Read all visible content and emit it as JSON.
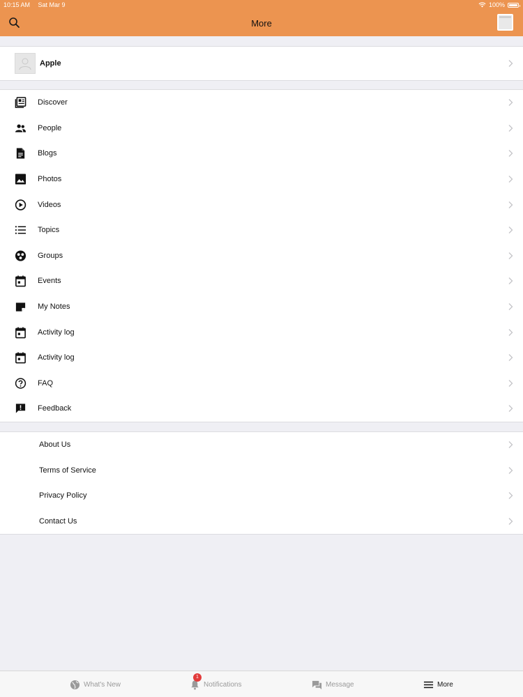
{
  "status_bar": {
    "time": "10:15 AM",
    "date": "Sat Mar 9",
    "battery": "100%",
    "battery_level": 1.0
  },
  "nav": {
    "title": "More",
    "search_icon": "search-icon",
    "avatar_icon": "profile-thumbnail"
  },
  "profile": {
    "name": "Apple",
    "avatar_icon": "person-placeholder-icon"
  },
  "menu": {
    "items": [
      {
        "label": "Discover",
        "icon": "newspaper-icon"
      },
      {
        "label": "People",
        "icon": "people-icon"
      },
      {
        "label": "Blogs",
        "icon": "document-icon"
      },
      {
        "label": "Photos",
        "icon": "photo-icon"
      },
      {
        "label": "Videos",
        "icon": "play-circle-icon"
      },
      {
        "label": "Topics",
        "icon": "list-icon"
      },
      {
        "label": "Groups",
        "icon": "groups-icon"
      },
      {
        "label": "Events",
        "icon": "calendar-icon"
      },
      {
        "label": "My Notes",
        "icon": "note-icon"
      },
      {
        "label": "Activity log",
        "icon": "calendar-icon"
      },
      {
        "label": "Activity log",
        "icon": "calendar-icon"
      },
      {
        "label": "FAQ",
        "icon": "question-circle-icon"
      },
      {
        "label": "Feedback",
        "icon": "feedback-icon"
      }
    ]
  },
  "footer_links": {
    "items": [
      {
        "label": "About Us"
      },
      {
        "label": "Terms of Service"
      },
      {
        "label": "Privacy Policy"
      },
      {
        "label": "Contact Us"
      }
    ]
  },
  "tabbar": {
    "tabs": [
      {
        "label": "What's New",
        "icon": "globe-icon",
        "active": false
      },
      {
        "label": "Notifications",
        "icon": "bell-icon",
        "active": false,
        "badge": "1"
      },
      {
        "label": "Message",
        "icon": "chat-icon",
        "active": false
      },
      {
        "label": "More",
        "icon": "menu-icon",
        "active": true
      }
    ]
  },
  "colors": {
    "header": "#ec9450",
    "background": "#efeff4",
    "badge": "#e23b3b",
    "inactive_tab": "#9a9a9a"
  }
}
